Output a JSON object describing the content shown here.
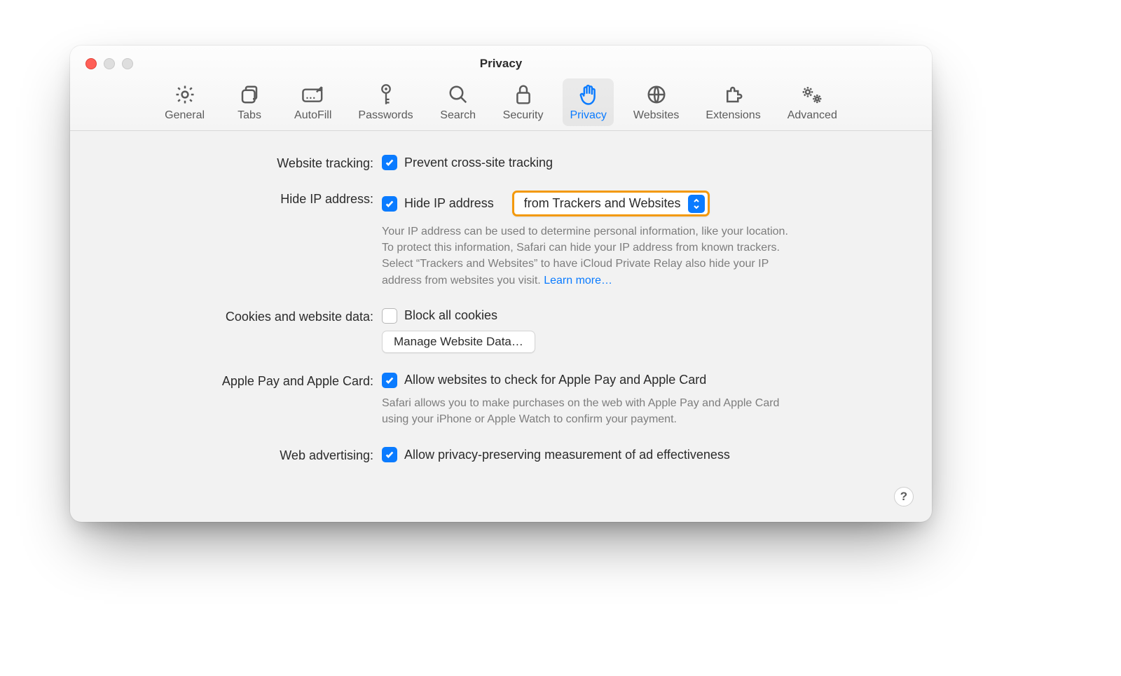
{
  "window": {
    "title": "Privacy"
  },
  "toolbar": {
    "items": [
      {
        "id": "general",
        "label": "General"
      },
      {
        "id": "tabs",
        "label": "Tabs"
      },
      {
        "id": "autofill",
        "label": "AutoFill"
      },
      {
        "id": "passwords",
        "label": "Passwords"
      },
      {
        "id": "search",
        "label": "Search"
      },
      {
        "id": "security",
        "label": "Security"
      },
      {
        "id": "privacy",
        "label": "Privacy"
      },
      {
        "id": "websites",
        "label": "Websites"
      },
      {
        "id": "extensions",
        "label": "Extensions"
      },
      {
        "id": "advanced",
        "label": "Advanced"
      }
    ],
    "active": "privacy"
  },
  "sections": {
    "tracking": {
      "label": "Website tracking:",
      "checkbox_label": "Prevent cross-site tracking",
      "checked": true
    },
    "hide_ip": {
      "label": "Hide IP address:",
      "checkbox_label": "Hide IP address",
      "checked": true,
      "select_value": "from Trackers and Websites",
      "description": "Your IP address can be used to determine personal information, like your location. To protect this information, Safari can hide your IP address from known trackers. Select “Trackers and Websites” to have iCloud Private Relay also hide your IP address from websites you visit. ",
      "learn_more": "Learn more…"
    },
    "cookies": {
      "label": "Cookies and website data:",
      "checkbox_label": "Block all cookies",
      "checked": false,
      "button_label": "Manage Website Data…"
    },
    "applepay": {
      "label": "Apple Pay and Apple Card:",
      "checkbox_label": "Allow websites to check for Apple Pay and Apple Card",
      "checked": true,
      "description": "Safari allows you to make purchases on the web with Apple Pay and Apple Card using your iPhone or Apple Watch to confirm your payment."
    },
    "webads": {
      "label": "Web advertising:",
      "checkbox_label": "Allow privacy-preserving measurement of ad effectiveness",
      "checked": true
    }
  },
  "help_button": "?"
}
